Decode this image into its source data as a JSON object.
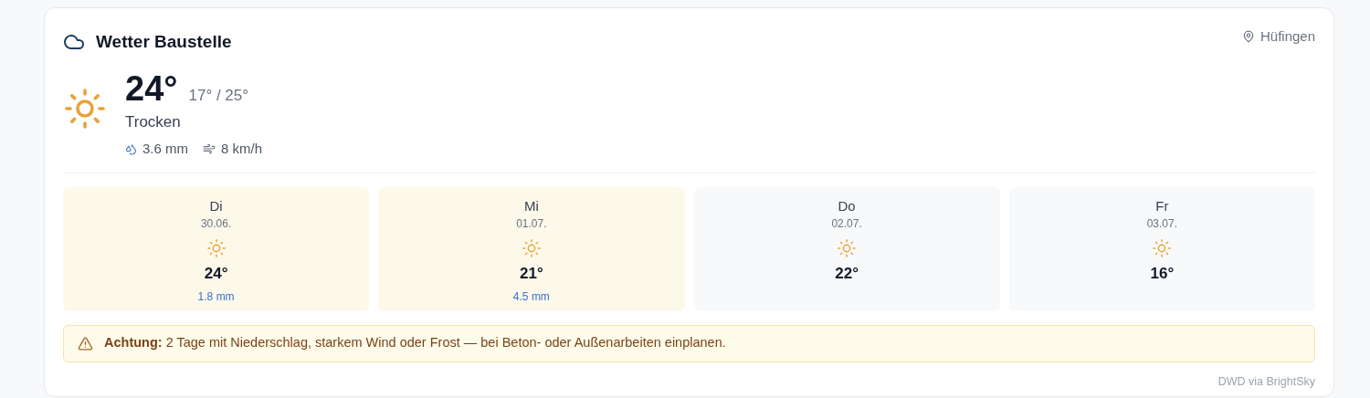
{
  "header": {
    "title": "Wetter Baustelle",
    "location": "Hüfingen"
  },
  "current": {
    "temperature": "24°",
    "range": "17° / 25°",
    "condition": "Trocken",
    "precipitation": "3.6 mm",
    "wind": "8 km/h"
  },
  "days": [
    {
      "day": "Di",
      "date": "30.06.",
      "temperature": "24°",
      "precipitation": "1.8 mm",
      "wet": true
    },
    {
      "day": "Mi",
      "date": "01.07.",
      "temperature": "21°",
      "precipitation": "4.5 mm",
      "wet": true
    },
    {
      "day": "Do",
      "date": "02.07.",
      "temperature": "22°",
      "wet": false
    },
    {
      "day": "Fr",
      "date": "03.07.",
      "temperature": "16°",
      "wet": false
    }
  ],
  "alert": {
    "text": "**Achtung:** 2 Tage mit Niederschlag, starkem Wind oder Frost — bei Beton- oder Außenarbeiten einplanen."
  },
  "source": "DWD via BrightSky"
}
